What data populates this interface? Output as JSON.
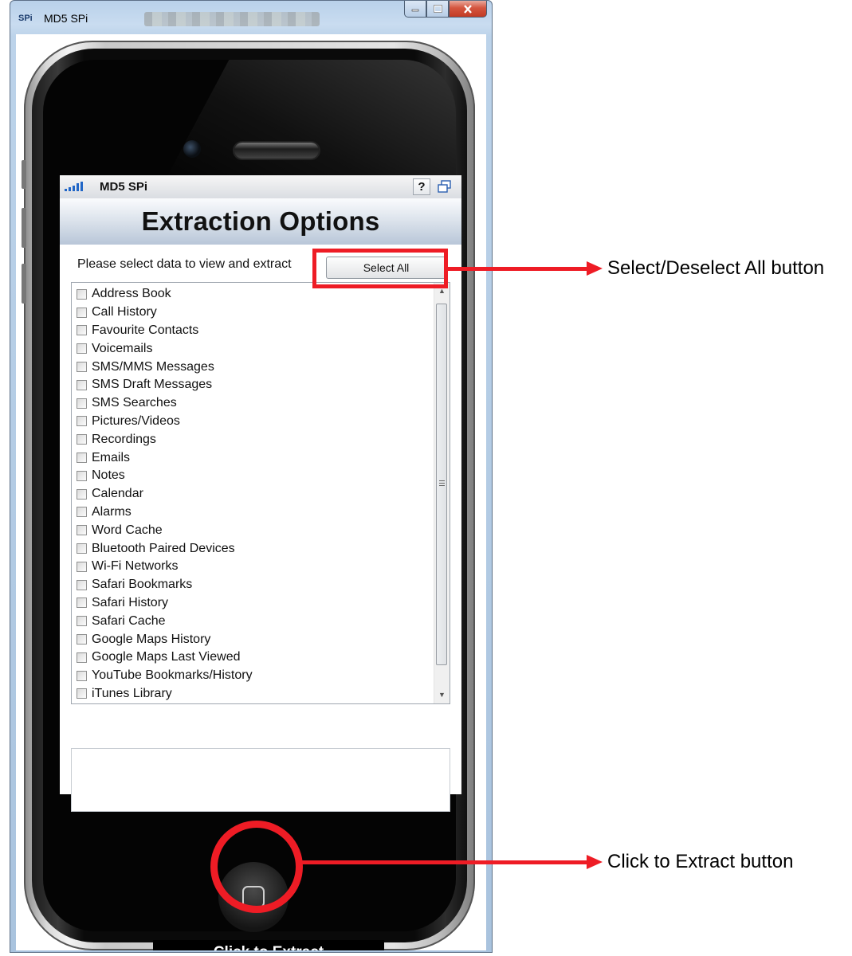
{
  "window": {
    "logo_text": "SPi",
    "title": "MD5 SPi"
  },
  "app": {
    "title": "MD5 SPi",
    "help_label": "?",
    "heading": "Extraction Options",
    "prompt": "Please select data to view and extract",
    "select_all_label": "Select All",
    "items": [
      {
        "label": "Address Book",
        "checked": false
      },
      {
        "label": "Call History",
        "checked": false
      },
      {
        "label": "Favourite Contacts",
        "checked": false
      },
      {
        "label": "Voicemails",
        "checked": false
      },
      {
        "label": "SMS/MMS Messages",
        "checked": false
      },
      {
        "label": "SMS Draft Messages",
        "checked": false
      },
      {
        "label": "SMS Searches",
        "checked": false
      },
      {
        "label": "Pictures/Videos",
        "checked": false
      },
      {
        "label": "Recordings",
        "checked": false
      },
      {
        "label": "Emails",
        "checked": false
      },
      {
        "label": "Notes",
        "checked": false
      },
      {
        "label": "Calendar",
        "checked": false
      },
      {
        "label": "Alarms",
        "checked": false
      },
      {
        "label": "Word Cache",
        "checked": false
      },
      {
        "label": "Bluetooth Paired Devices",
        "checked": false
      },
      {
        "label": "Wi-Fi Networks",
        "checked": false
      },
      {
        "label": "Safari Bookmarks",
        "checked": false
      },
      {
        "label": "Safari History",
        "checked": false
      },
      {
        "label": "Safari Cache",
        "checked": false
      },
      {
        "label": "Google Maps History",
        "checked": false
      },
      {
        "label": "Google Maps Last Viewed",
        "checked": false
      },
      {
        "label": "YouTube Bookmarks/History",
        "checked": false
      },
      {
        "label": "iTunes Library",
        "checked": false
      }
    ]
  },
  "phone": {
    "extract_label": "Click to Extract"
  },
  "annotations": {
    "select_all": "Select/Deselect All button",
    "extract": "Click to Extract button",
    "color": "#ee1c25"
  },
  "icons": [
    "signal-bars-icon",
    "help-icon",
    "restore-icon",
    "minimize-icon",
    "maximize-icon",
    "close-icon",
    "home-button-icon"
  ]
}
